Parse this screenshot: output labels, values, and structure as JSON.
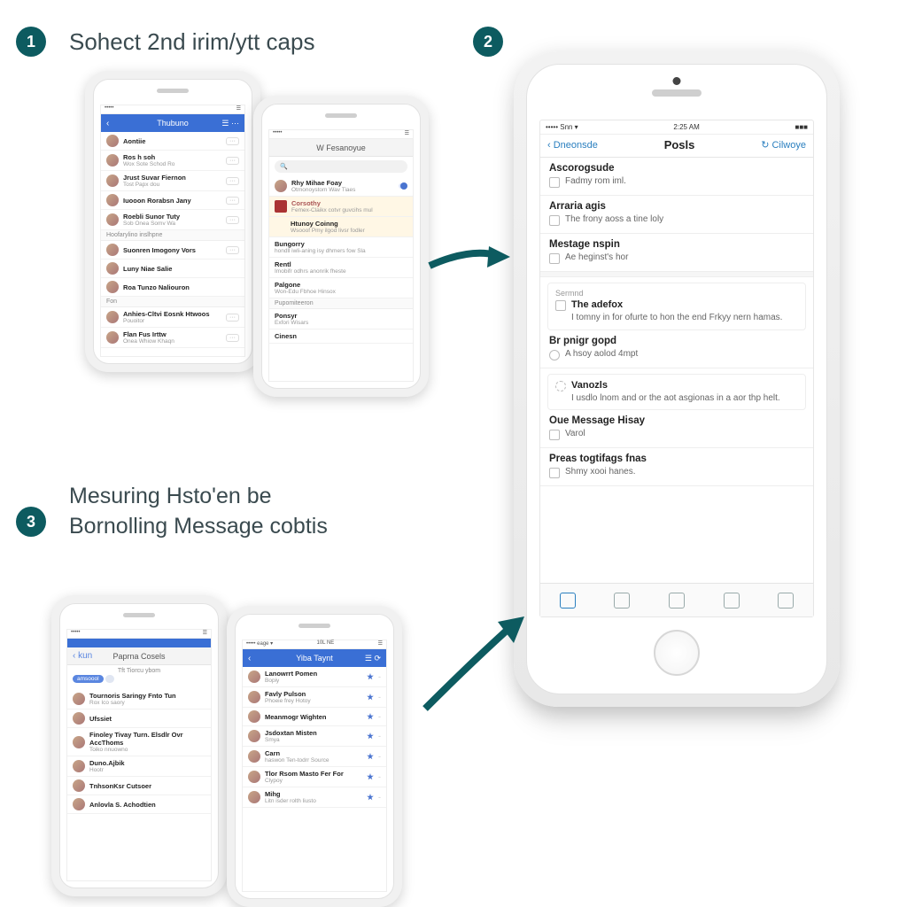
{
  "steps": {
    "s1": {
      "num": "1",
      "label": "Sohect 2nd irim/ytt caps"
    },
    "s2": {
      "num": "2"
    },
    "s3": {
      "num": "3",
      "label": "Mesuring Hsto'en be Bornolling Message cobtis"
    }
  },
  "mini1a": {
    "status_l": "•••••",
    "status_r": "☰",
    "nav_title": "Thubuno",
    "rows": [
      {
        "name": "Aontiie",
        "sub": "",
        "info": "···"
      },
      {
        "name": "Ros h soh",
        "sub": "Wox Sote Schod Ro",
        "info": "···"
      },
      {
        "name": "Jrust Suvar Fiernon",
        "sub": "Tost Papx dou",
        "info": "···"
      },
      {
        "name": "Iuooon Rorabsn Jany",
        "sub": "",
        "info": "···"
      },
      {
        "name": "Roebli Sunor Tuty",
        "sub": "Sob Onea Somv Wa",
        "info": "···"
      }
    ],
    "header1": "Hoofarylino inslhpne",
    "rows2": [
      {
        "name": "Suonren Imogony Vors",
        "sub": "",
        "info": "···"
      },
      {
        "name": "Luny Niae Salie",
        "sub": "",
        "info": ""
      },
      {
        "name": "Roa Tunzo Naliouron",
        "sub": "",
        "info": ""
      }
    ],
    "header2": "Fon",
    "rows3": [
      {
        "name": "Anhies-Cltvi Eosnk Htwoos",
        "sub": "Pouoitor",
        "info": "···"
      },
      {
        "name": "Flan Fus Irttw",
        "sub": "Onea Whiow Khaqn",
        "info": "···"
      }
    ]
  },
  "mini1b": {
    "status_l": "•••••",
    "status_r": "☰",
    "nav_title": "W Fesanoyue",
    "search": "Q",
    "item_top": {
      "name": "Rhy Mihae Foay",
      "sub": "Otmonoystom Wav Tiaes"
    },
    "hi1": {
      "name": "Corsothy",
      "sub": "Femex-Claikx cotvr guvcihs mul"
    },
    "hi2": {
      "name": "Htunoy Coinng",
      "sub": "Wsooof Pmy ilgod livsr fodler"
    },
    "rows": [
      {
        "name": "Bungorry",
        "sub": "hondll iwli-aning isy dhmers fow Sla"
      },
      {
        "name": "Rentl",
        "sub": "Imobifr odhrs anonrik fheste"
      },
      {
        "name": "Palgone",
        "sub": "Won-Edu Fbhoe Hinsox"
      }
    ],
    "header1": "Pupomiteeron",
    "rows2": [
      {
        "name": "Ponsyr",
        "sub": "Exfori Wisars"
      },
      {
        "name": "Cinesn",
        "sub": ""
      }
    ]
  },
  "large": {
    "status_l": "••••• Snn ▾",
    "status_c": "2:25 AM",
    "status_r": "■■■",
    "nav_back": "‹ Dneonsde",
    "nav_title": "Posls",
    "nav_right": "↻ Cilwoye",
    "sections": [
      {
        "title": "Ascorogsude",
        "text": "Fadmy rom iml."
      },
      {
        "title": "Arraria agis",
        "text": "The frony aoss a tine loly"
      },
      {
        "title": "Mestage nspin",
        "text": "Ae heginst's hor"
      }
    ],
    "card1_label": "Sermnd",
    "card1_title": "The adefox",
    "card1_text": "I tomny in for ofurte to hon the end Frkyy nern hamas.",
    "sections2": [
      {
        "title": "Br pnigr gopd",
        "text": "A hsoy aolod 4mpt"
      }
    ],
    "card2_title": "Vanozls",
    "card2_text": "I usdlo lnom and or the aot asgionas in a aor thp helt.",
    "sections3": [
      {
        "title": "Oue Message Hisay",
        "text": "Varol"
      },
      {
        "title": "Preas togtifags fnas",
        "text": "Shmy xooi hanes."
      }
    ],
    "tabs": [
      "home",
      "",
      "",
      "",
      ""
    ]
  },
  "mini3a": {
    "status_l": "•••••",
    "status_r": "☰",
    "nav_back": "‹ kun",
    "nav_title": "Paprna Cosels",
    "subhead": "Tft Tiorcu ybom",
    "pill_on": "amsoool",
    "pill_off": "",
    "rows": [
      {
        "name": "Tournoris Saringy Fnto Tun",
        "sub": "Rox Ico saory"
      },
      {
        "name": "Ufssiet",
        "sub": ""
      },
      {
        "name": "Finoley Tivay Turn. Elsdlr Ovr AccThoms",
        "sub": "Toiko nnuowno"
      },
      {
        "name": "Duno.Ajbik",
        "sub": "Hootr"
      },
      {
        "name": "TnhsonKsr Cutsoer",
        "sub": ""
      },
      {
        "name": "Anlovla S. Achodtien",
        "sub": ""
      }
    ]
  },
  "mini3b": {
    "status_l": "••••• eage ▾",
    "status_c": "10L NE",
    "status_r": "☰",
    "nav_back": "‹",
    "nav_title": "Yiba Taynt",
    "rows": [
      {
        "name": "Lanowrrt Pomen",
        "sub": "Bopiy"
      },
      {
        "name": "Favly Pulson",
        "sub": "Phoeie frey Hotoy"
      },
      {
        "name": "Meanmogr Wighten",
        "sub": ""
      },
      {
        "name": "Jsdoxtan Misten",
        "sub": "Smya"
      },
      {
        "name": "Carn",
        "sub": "haswon Ten-todrr Source"
      },
      {
        "name": "Tlor Rsom Masto Fer For",
        "sub": "Clypoy"
      },
      {
        "name": "Mihg",
        "sub": "Litn isder rolth liusto"
      }
    ]
  }
}
